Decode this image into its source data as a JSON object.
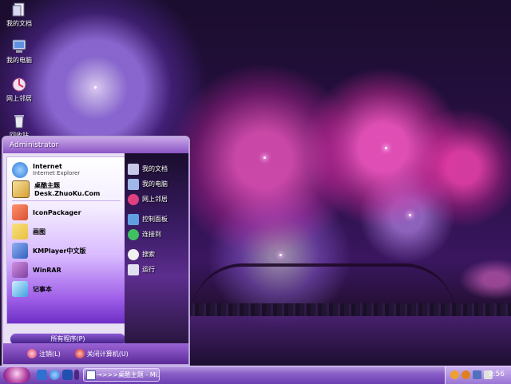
{
  "desktop": {
    "icons": [
      {
        "label": "我的文档",
        "icon": "my-documents-icon"
      },
      {
        "label": "我的电脑",
        "icon": "my-computer-icon"
      },
      {
        "label": "网上邻居",
        "icon": "network-places-icon"
      },
      {
        "label": "回收站",
        "icon": "recycle-bin-icon"
      }
    ]
  },
  "start_menu": {
    "user": "Administrator",
    "pinned": [
      {
        "title": "Internet",
        "subtitle": "Internet Explorer",
        "icon": "internet-explorer-icon",
        "color": "#2a7ad8"
      },
      {
        "title": "桌酷主题Desk.ZhuoKu.Com",
        "icon": "zhuoku-icon",
        "color": "#d8a030"
      }
    ],
    "recent": [
      {
        "title": "IconPackager",
        "icon": "iconpackager-icon",
        "color": "#d85030"
      },
      {
        "title": "画图",
        "icon": "paint-icon",
        "color": "#e8c040"
      },
      {
        "title": "KMPlayer中文版",
        "icon": "kmplayer-icon",
        "color": "#3060c0"
      },
      {
        "title": "WinRAR",
        "icon": "winrar-icon",
        "color": "#8040a0"
      },
      {
        "title": "记事本",
        "icon": "notepad-icon",
        "color": "#40a0e0"
      }
    ],
    "all_programs": "所有程序(P)",
    "right": [
      {
        "label": "我的文档",
        "icon": "my-documents-icon",
        "color": "#c8c8e8"
      },
      {
        "label": "我的电脑",
        "icon": "my-computer-icon",
        "color": "#a0b8e8"
      },
      {
        "label": "网上邻居",
        "icon": "network-places-icon",
        "color": "#e04080"
      },
      {
        "label": "控制面板",
        "icon": "control-panel-icon",
        "color": "#60a0e0"
      },
      {
        "label": "连接到",
        "icon": "connect-to-icon",
        "color": "#40c060"
      },
      {
        "label": "搜索",
        "icon": "search-icon",
        "color": "#f0f0f0"
      },
      {
        "label": "运行",
        "icon": "run-icon",
        "color": "#e0e0f0"
      }
    ],
    "footer": {
      "logoff": "注销(L)",
      "shutdown": "关闭计算机(U)"
    }
  },
  "taskbar": {
    "task_label": "→>>>桌酷主题 - Mi...",
    "clock": "9:56"
  }
}
